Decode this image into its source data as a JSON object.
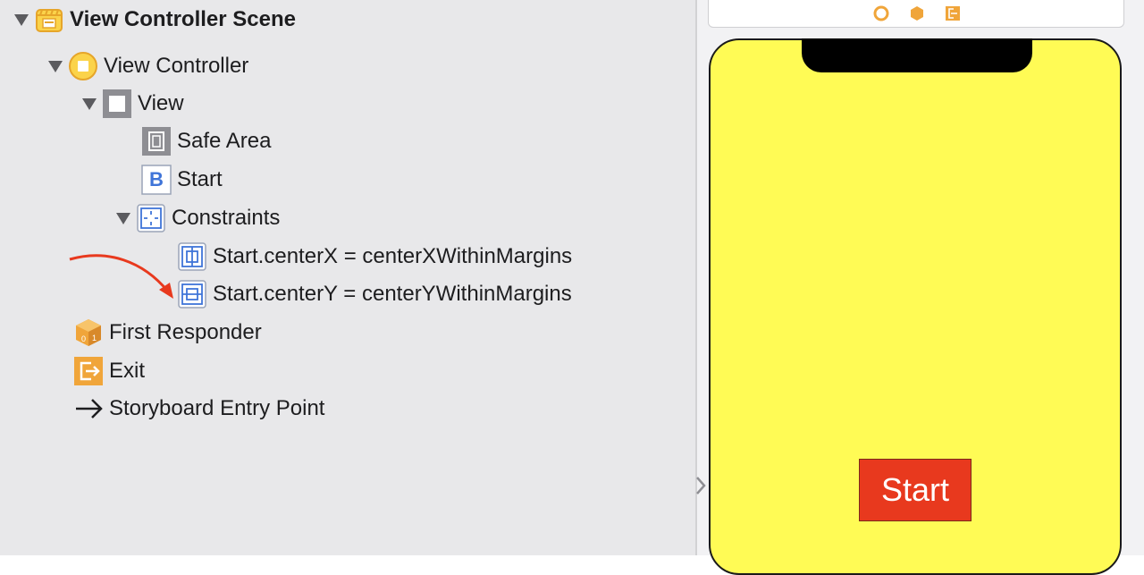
{
  "outline": {
    "scene": "View Controller Scene",
    "view_controller": "View Controller",
    "view": "View",
    "safe_area": "Safe Area",
    "start_button": "Start",
    "start_badge": "B",
    "constraints": "Constraints",
    "constraint_x": "Start.centerX = centerXWithinMargins",
    "constraint_y": "Start.centerY = centerYWithinMargins",
    "first_responder": "First Responder",
    "exit": "Exit",
    "entry_point": "Storyboard Entry Point"
  },
  "canvas": {
    "button_label": "Start",
    "background_color": "#fffb55",
    "button_color": "#e8391e"
  },
  "colors": {
    "accent_blue": "#3f74d8",
    "icon_orange": "#f0a53a",
    "annotation_red": "#e8391e"
  }
}
